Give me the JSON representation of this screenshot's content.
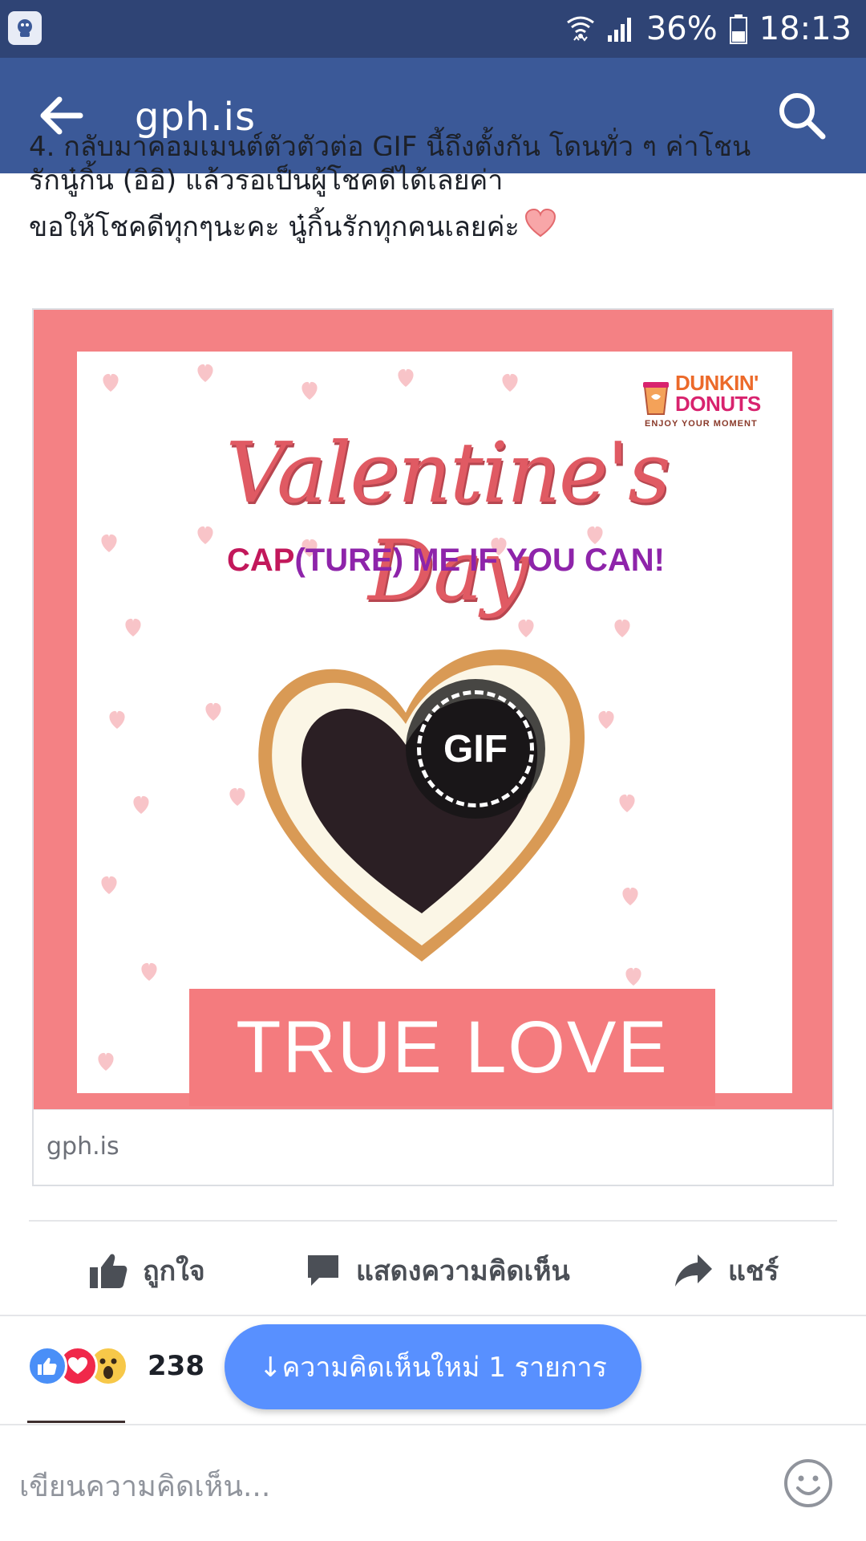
{
  "status_bar": {
    "battery_percent": "36%",
    "time": "18:13"
  },
  "app_bar": {
    "title": "gph.is",
    "back_icon": "back-arrow-icon",
    "search_icon": "search-icon"
  },
  "post": {
    "cut_line": "4. กลับมาคอมเมนต์ตัวตัวต่อ GIF นี้ถึงตั้งกัน โดนทั่ว ๆ ค่าโชน",
    "line_2": "รักนู๋กิ้น (อิอิ) แล้วรอเป็นผู้โชคดีได้เลยค่า",
    "line_3": "ขอให้โชคดีทุกๆนะคะ นู๋กิ้นรักทุกคนเลยค่ะ"
  },
  "card": {
    "logo_line1": "DUNKIN'",
    "logo_line2": "DONUTS",
    "logo_tagline": "ENJOY YOUR MOMENT",
    "title": "Valentine's Day",
    "tagline_a": "CAP",
    "tagline_b": "(TURE) ME IF YOU CAN!",
    "gif_badge": "GIF",
    "banner": "TRUE LOVE",
    "domain": "gph.is"
  },
  "actions": {
    "like": "ถูกใจ",
    "comment": "แสดงความคิดเห็น",
    "share": "แชร์"
  },
  "reactions": {
    "count": "238",
    "types": [
      "like",
      "love",
      "wow"
    ]
  },
  "new_comments": {
    "label": "↓ความคิดเห็นใหม่ 1 รายการ"
  },
  "composer": {
    "placeholder": "เขียนความคิดเห็น..."
  },
  "colors": {
    "status_bar": "#2f4475",
    "app_bar": "#3b5998",
    "pill": "#5890ff",
    "card_frame": "#f48184"
  }
}
